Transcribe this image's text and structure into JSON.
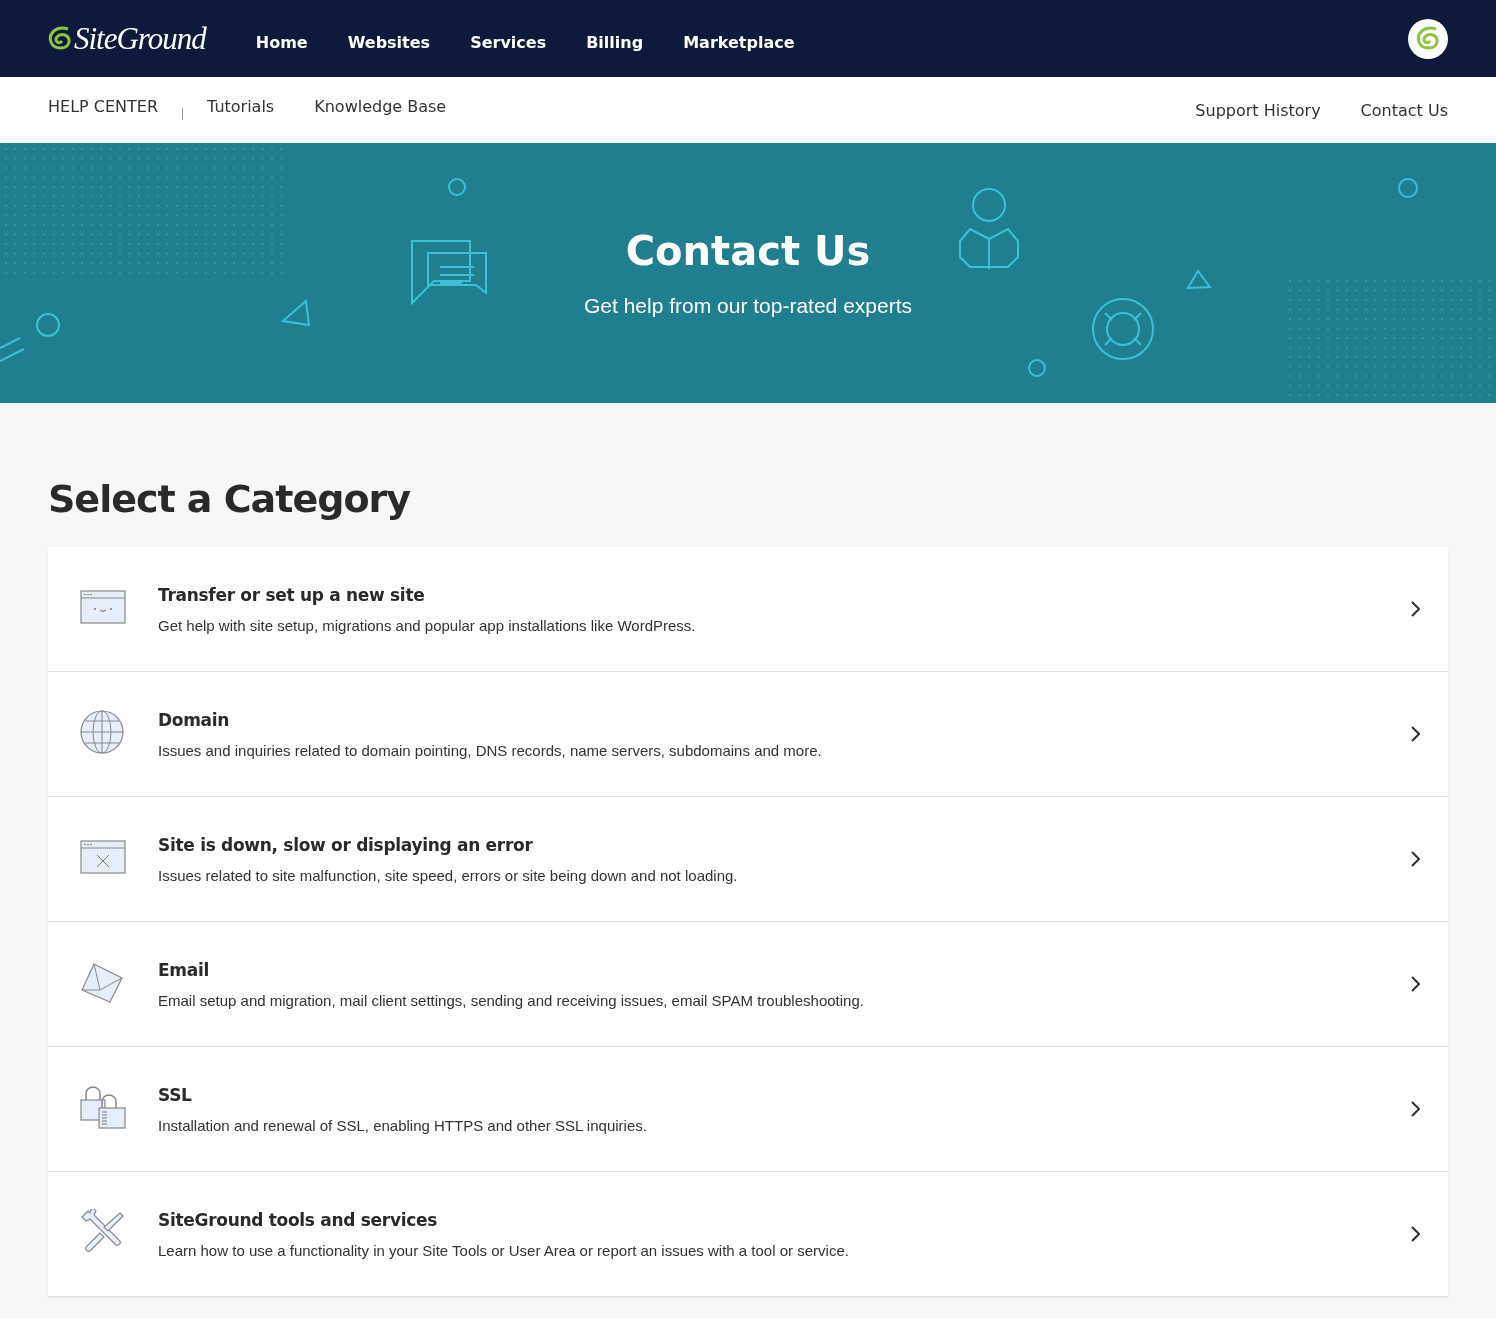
{
  "top_bar": {
    "logo_text": "SiteGround",
    "nav": [
      "Home",
      "Websites",
      "Services",
      "Billing",
      "Marketplace"
    ]
  },
  "sub_nav": {
    "section": "HELP CENTER",
    "left_links": [
      "Tutorials",
      "Knowledge Base"
    ],
    "right_links": [
      "Support History",
      "Contact Us"
    ]
  },
  "hero": {
    "title": "Contact Us",
    "subtitle": "Get help from our top-rated experts"
  },
  "heading": "Select a Category",
  "categories": [
    {
      "kind": "browser-smile",
      "title": "Transfer or set up a new site",
      "description": "Get help with site setup, migrations and popular app installations like WordPress."
    },
    {
      "kind": "globe",
      "title": "Domain",
      "description": "Issues and inquiries related to domain pointing, DNS records, name servers, subdomains and more."
    },
    {
      "kind": "browser-error",
      "title": "Site is down, slow or displaying an error",
      "description": "Issues related to site malfunction, site speed, errors or site being down and not loading."
    },
    {
      "kind": "envelope",
      "title": "Email",
      "description": "Email setup and migration, mail client settings, sending and receiving issues, email SPAM troubleshooting."
    },
    {
      "kind": "padlocks",
      "title": "SSL",
      "description": "Installation and renewal of SSL, enabling HTTPS and other SSL inquiries."
    },
    {
      "kind": "tools",
      "title": "SiteGround tools and services",
      "description": "Learn how to use a functionality in your Site Tools or User Area or report an issues with a tool or service."
    }
  ]
}
